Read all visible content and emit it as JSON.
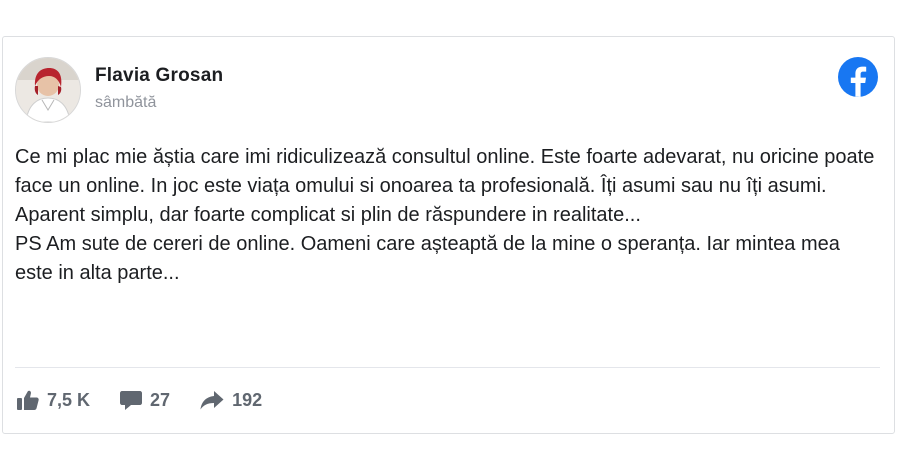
{
  "post": {
    "author": "Flavia Grosan",
    "time": "sâmbătă",
    "body": [
      "Ce mi plac mie ăștia care imi ridiculizează consultul online. Este foarte adevarat, nu oricine poate face un online. In joc este viața omului si onoarea ta profesională. Îți asumi sau nu îți asumi. Aparent simplu, dar foarte complicat si plin de răspundere in realitate...",
      "PS Am sute de cereri de online. Oameni care așteaptă de la mine o speranța. Iar mintea mea este in alta parte..."
    ]
  },
  "stats": {
    "likes": "7,5 K",
    "comments": "27",
    "shares": "192"
  },
  "icons": {
    "platform": "facebook-logo-icon",
    "like": "thumbs-up-icon",
    "comment": "speech-bubble-icon",
    "share": "share-arrow-icon"
  },
  "colors": {
    "brand": "#1877f2",
    "text": "#1c1e21",
    "muted": "#90949c",
    "stat": "#606770"
  }
}
